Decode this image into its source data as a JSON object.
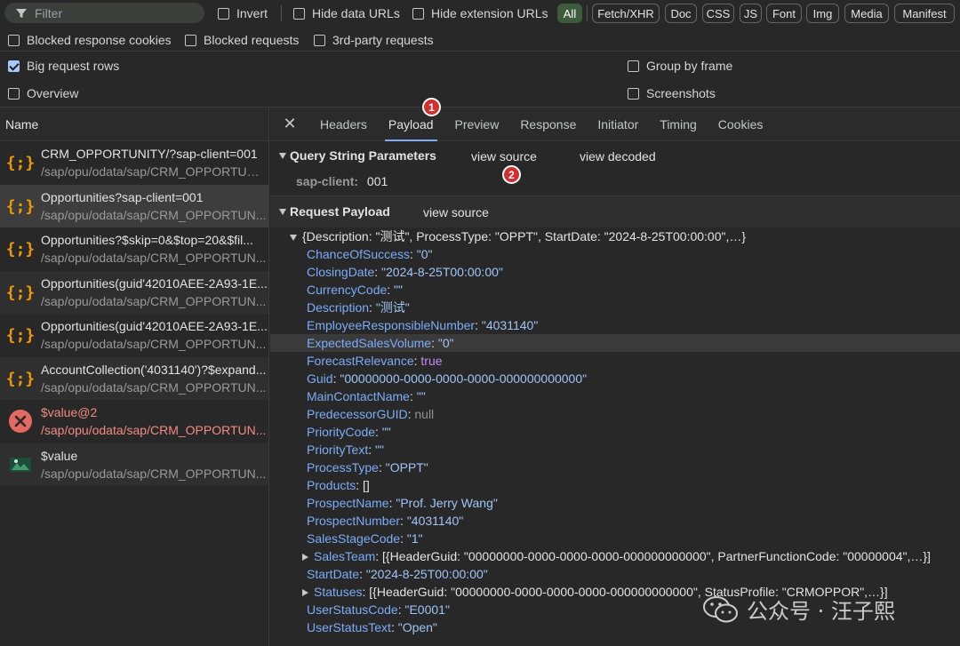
{
  "toolbar": {
    "filter_placeholder": "Filter",
    "invert": "Invert",
    "hide_data_urls": "Hide data URLs",
    "hide_extension_urls": "Hide extension URLs",
    "types": [
      "All",
      "Fetch/XHR",
      "Doc",
      "CSS",
      "JS",
      "Font",
      "Img",
      "Media",
      "Manifest"
    ]
  },
  "row2": {
    "blocked_response_cookies": "Blocked response cookies",
    "blocked_requests": "Blocked requests",
    "third_party": "3rd-party requests"
  },
  "options": {
    "big_request_rows": "Big request rows",
    "overview": "Overview",
    "group_by_frame": "Group by frame",
    "screenshots": "Screenshots"
  },
  "list": {
    "header": "Name",
    "requests": [
      {
        "name": "CRM_OPPORTUNITY/?sap-client=001",
        "path": "/sap/opu/odata/sap/CRM_OPPORTUNITY_..."
      },
      {
        "name": "Opportunities?sap-client=001",
        "path": "/sap/opu/odata/sap/CRM_OPPORTUN..."
      },
      {
        "name": "Opportunities?$skip=0&$top=20&$fil...",
        "path": "/sap/opu/odata/sap/CRM_OPPORTUN..."
      },
      {
        "name": "Opportunities(guid'42010AEE-2A93-1E...",
        "path": "/sap/opu/odata/sap/CRM_OPPORTUN..."
      },
      {
        "name": "Opportunities(guid'42010AEE-2A93-1E...",
        "path": "/sap/opu/odata/sap/CRM_OPPORTUN..."
      },
      {
        "name": "AccountCollection('4031140')?$expand...",
        "path": "/sap/opu/odata/sap/CRM_OPPORTUN..."
      },
      {
        "name": "$value@2",
        "path": "/sap/opu/odata/sap/CRM_OPPORTUN..."
      },
      {
        "name": "$value",
        "path": "/sap/opu/odata/sap/CRM_OPPORTUN..."
      }
    ]
  },
  "tabs": [
    "Headers",
    "Payload",
    "Preview",
    "Response",
    "Initiator",
    "Timing",
    "Cookies"
  ],
  "badges": {
    "one": "1",
    "two": "2"
  },
  "query": {
    "title": "Query String Parameters",
    "view_source": "view source",
    "view_decoded": "view decoded",
    "param_key": "sap-client:",
    "param_value": "001"
  },
  "payload": {
    "title": "Request Payload",
    "view_source": "view source",
    "summary": "{Description: \"测试\", ProcessType: \"OPPT\", StartDate: \"2024-8-25T00:00:00\",…}",
    "fields": [
      {
        "key": "ChanceOfSuccess",
        "value": "\"0\"",
        "kind": "string"
      },
      {
        "key": "ClosingDate",
        "value": "\"2024-8-25T00:00:00\"",
        "kind": "string"
      },
      {
        "key": "CurrencyCode",
        "value": "\"\"",
        "kind": "string"
      },
      {
        "key": "Description",
        "value": "\"测试\"",
        "kind": "string"
      },
      {
        "key": "EmployeeResponsibleNumber",
        "value": "\"4031140\"",
        "kind": "string"
      },
      {
        "key": "ExpectedSalesVolume",
        "value": "\"0\"",
        "kind": "string"
      },
      {
        "key": "ForecastRelevance",
        "value": "true",
        "kind": "bool"
      },
      {
        "key": "Guid",
        "value": "\"00000000-0000-0000-0000-000000000000\"",
        "kind": "string"
      },
      {
        "key": "MainContactName",
        "value": "\"\"",
        "kind": "string"
      },
      {
        "key": "PredecessorGUID",
        "value": "null",
        "kind": "null"
      },
      {
        "key": "PriorityCode",
        "value": "\"\"",
        "kind": "string"
      },
      {
        "key": "PriorityText",
        "value": "\"\"",
        "kind": "string"
      },
      {
        "key": "ProcessType",
        "value": "\"OPPT\"",
        "kind": "string"
      },
      {
        "key": "Products",
        "value": "[]",
        "kind": "plain"
      },
      {
        "key": "ProspectName",
        "value": "\"Prof. Jerry Wang\"",
        "kind": "string"
      },
      {
        "key": "ProspectNumber",
        "value": "\"4031140\"",
        "kind": "string"
      },
      {
        "key": "SalesStageCode",
        "value": "\"1\"",
        "kind": "string"
      },
      {
        "key": "SalesTeam",
        "value": "[{HeaderGuid: \"00000000-0000-0000-0000-000000000000\", PartnerFunctionCode: \"00000004\",…}]",
        "kind": "collapsed"
      },
      {
        "key": "StartDate",
        "value": "\"2024-8-25T00:00:00\"",
        "kind": "string"
      },
      {
        "key": "Statuses",
        "value": "[{HeaderGuid: \"00000000-0000-0000-0000-000000000000\", StatusProfile: \"CRMOPPOR\",…}]",
        "kind": "collapsed"
      },
      {
        "key": "UserStatusCode",
        "value": "\"E0001\"",
        "kind": "string"
      },
      {
        "key": "UserStatusText",
        "value": "\"Open\"",
        "kind": "string"
      }
    ]
  },
  "watermark": "公众号 · 汪子熙"
}
